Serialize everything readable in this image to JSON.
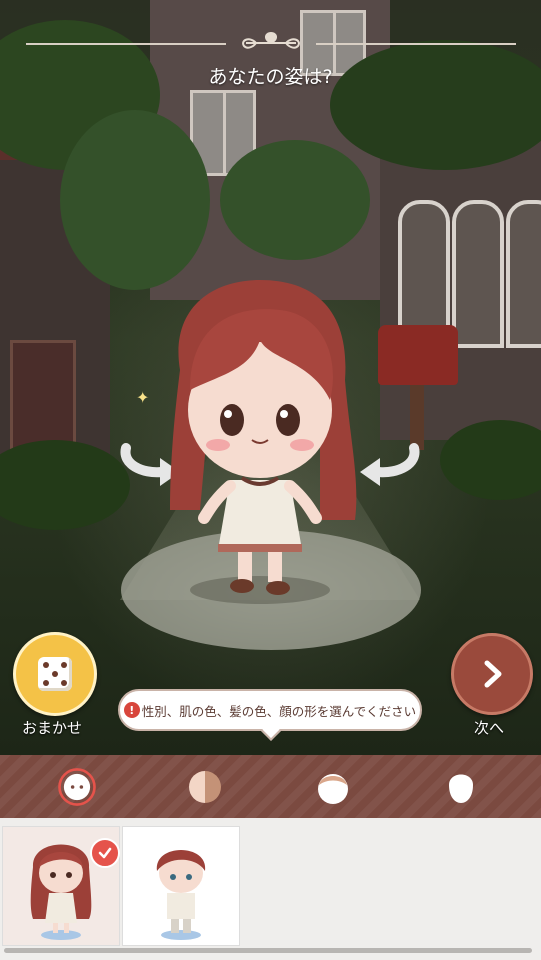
{
  "header": {
    "title": "あなたの姿は?"
  },
  "actions": {
    "random_label": "おまかせ",
    "next_label": "次へ"
  },
  "hint": {
    "text": "性別、肌の色、髪の色、顔の形を選んでください",
    "warn_glyph": "!"
  },
  "tabs": [
    {
      "icon": "face-icon",
      "active": true
    },
    {
      "icon": "skin-color-icon",
      "active": false
    },
    {
      "icon": "hair-color-icon",
      "active": false
    },
    {
      "icon": "face-shape-icon",
      "active": false
    }
  ],
  "options": [
    {
      "label": "girl",
      "selected": true
    },
    {
      "label": "boy",
      "selected": false
    }
  ],
  "colors": {
    "accent_red": "#e5534b",
    "tabbar": "#7b4a40",
    "dice_btn": "#f4c247",
    "next_btn": "#9a4a3c",
    "hair": "#9c4038"
  }
}
